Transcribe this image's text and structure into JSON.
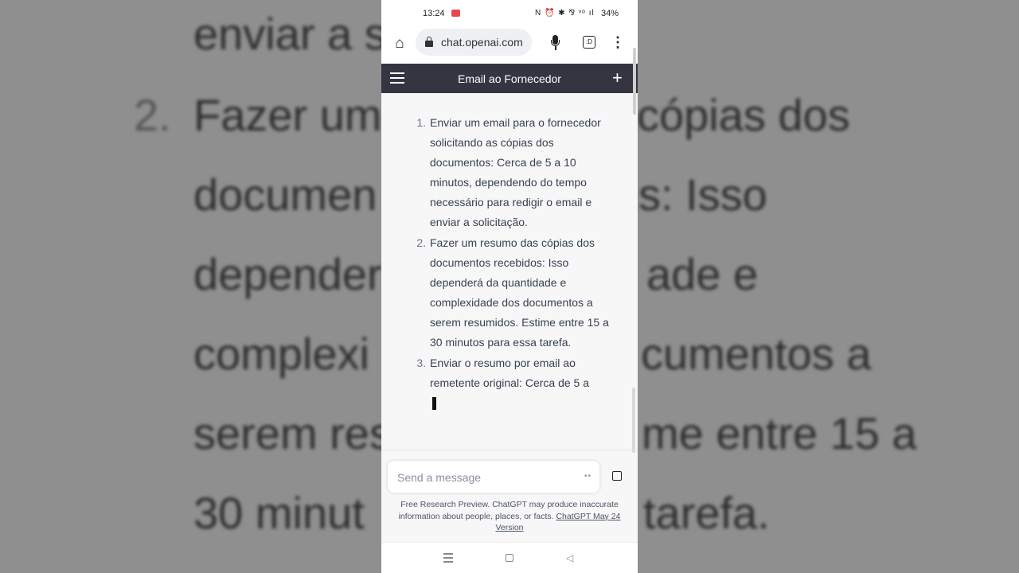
{
  "backdrop": {
    "lines": [
      "enviar a s",
      "Fazer um",
      "cópias dos",
      "documen",
      "s: Isso",
      "depender",
      "ade e",
      "complexi",
      "cumentos a",
      "serem res",
      "me entre 15 a",
      "30 minut",
      "tarefa."
    ],
    "number": "2."
  },
  "status_bar": {
    "time": "13:24",
    "icons": "N ⏰ ✱ ⅋ ᵛᵒ ıl",
    "battery": "34%"
  },
  "browser": {
    "url": "chat.openai.com",
    "tabs_label": ":D"
  },
  "app_bar": {
    "title": "Email ao Fornecedor"
  },
  "message": {
    "items": [
      {
        "number": "1.",
        "text": "Enviar um email para o fornecedor solicitando as cópias dos documentos: Cerca de 5 a 10 minutos, dependendo do tempo necessário para redigir o email e enviar a solicitação."
      },
      {
        "number": "2.",
        "text": "Fazer um resumo das cópias dos documentos recebidos: Isso dependerá da quantidade e complexidade dos documentos a serem resumidos. Estime entre 15 a 30 minutos para essa tarefa."
      },
      {
        "number": "3.",
        "text": "Enviar o resumo por email ao remetente original: Cerca de 5 a"
      }
    ]
  },
  "composer": {
    "placeholder": "Send a message",
    "typing_indicator": "••"
  },
  "disclaimer": {
    "text": "Free Research Preview. ChatGPT may produce inaccurate information about people, places, or facts.",
    "link": "ChatGPT May 24 Version"
  },
  "colors": {
    "app_bar_bg": "#343541",
    "page_bg": "#f7f7f8"
  }
}
